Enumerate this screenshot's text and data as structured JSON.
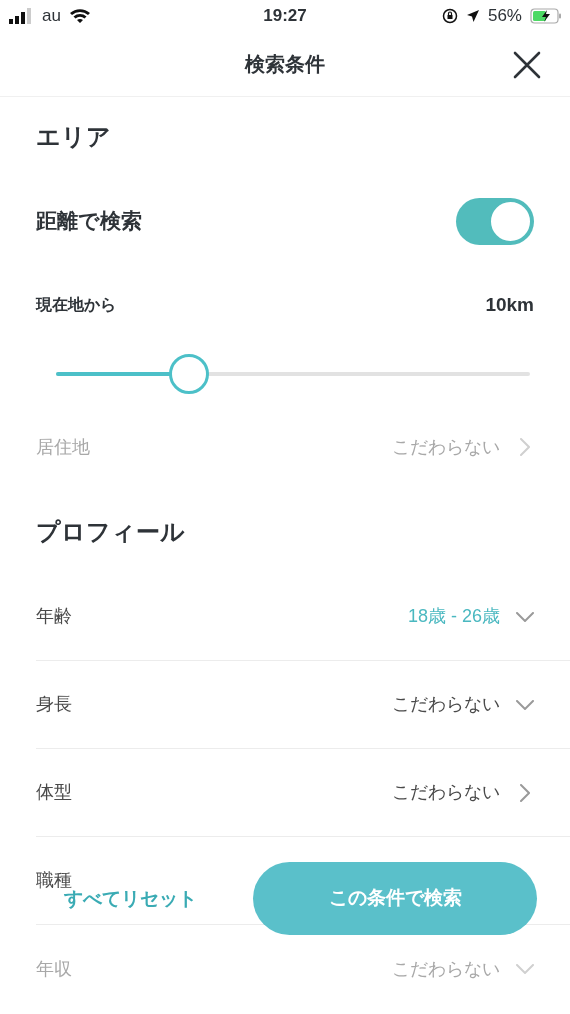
{
  "status_bar": {
    "carrier": "au",
    "time": "19:27",
    "battery": "56%"
  },
  "header": {
    "title": "検索条件"
  },
  "area": {
    "heading": "エリア",
    "distance_toggle": {
      "label": "距離で検索",
      "on": true
    },
    "distance": {
      "label": "現在地から",
      "reading": "10km",
      "level": 0.28
    },
    "residence": {
      "label": "居住地",
      "value": "こだわらない",
      "kind": "link",
      "disabled": true
    }
  },
  "profile": {
    "heading": "プロフィール",
    "rows": [
      {
        "label": "年齢",
        "value": "18歳 - 26歳",
        "kind": "dropdown",
        "active": true,
        "disabled": false
      },
      {
        "label": "身長",
        "value": "こだわらない",
        "kind": "dropdown",
        "active": false,
        "disabled": false
      },
      {
        "label": "体型",
        "value": "こだわらない",
        "kind": "link",
        "active": false,
        "disabled": false
      },
      {
        "label": "職種",
        "disabled": false
      },
      {
        "label": "年収",
        "value": "こだわらない",
        "kind": "dropdown",
        "active": false,
        "disabled": true
      }
    ]
  },
  "footer": {
    "reset": "すべてリセット",
    "search": "この条件で検索"
  }
}
